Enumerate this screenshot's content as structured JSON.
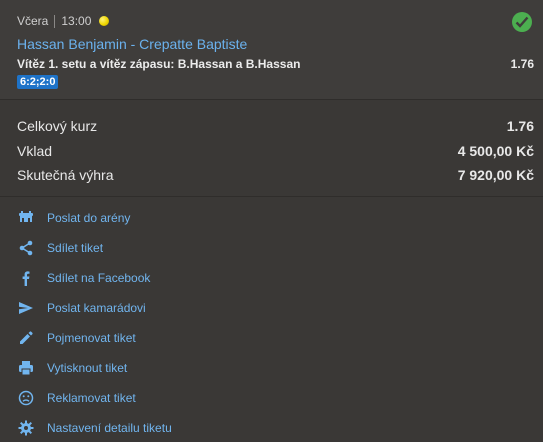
{
  "bet": {
    "day": "Včera",
    "time": "13:00",
    "sport_icon": "tennis-ball-icon",
    "status_icon": "check-circle-icon",
    "status_color": "#4caf50",
    "match": "Hassan Benjamin - Crepatte Baptiste",
    "market": "Vítěz 1. setu a vítěz zápasu: B.Hassan a B.Hassan",
    "odds": "1.76",
    "score": "6:2;2:0"
  },
  "summary": {
    "total_odds_label": "Celkový kurz",
    "total_odds_value": "1.76",
    "stake_label": "Vklad",
    "stake_value": "4 500,00 Kč",
    "payout_label": "Skutečná výhra",
    "payout_value": "7 920,00 Kč"
  },
  "actions": [
    {
      "label": "Poslat do arény",
      "icon": "arena-icon"
    },
    {
      "label": "Sdílet tiket",
      "icon": "share-icon"
    },
    {
      "label": "Sdílet na Facebook",
      "icon": "facebook-icon"
    },
    {
      "label": "Poslat kamarádovi",
      "icon": "send-icon"
    },
    {
      "label": "Pojmenovat tiket",
      "icon": "pencil-icon"
    },
    {
      "label": "Vytisknout tiket",
      "icon": "printer-icon"
    },
    {
      "label": "Reklamovat tiket",
      "icon": "sad-face-icon"
    },
    {
      "label": "Nastavení detailu tiketu",
      "icon": "gear-icon"
    }
  ],
  "colors": {
    "accent": "#71b5ef",
    "score_badge": "#1e73c8"
  }
}
